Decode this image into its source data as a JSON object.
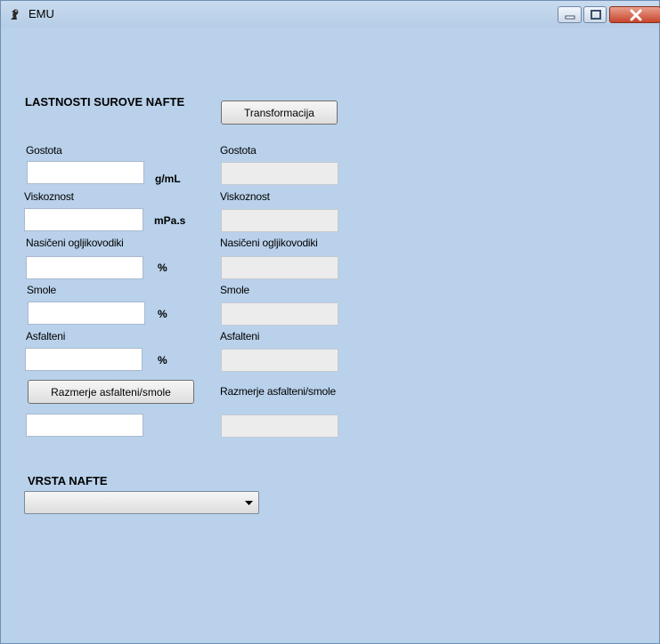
{
  "window": {
    "title": "EMU"
  },
  "section": {
    "heading": "LASTNOSTI SUROVE NAFTE",
    "transform_button": "Transformacija"
  },
  "inputs": {
    "gostota": {
      "label": "Gostota",
      "unit": "g/mL",
      "value": ""
    },
    "viskoznost": {
      "label": "Viskoznost",
      "unit": "mPa.s",
      "value": ""
    },
    "nasiceni": {
      "label": "Nasičeni ogljikovodiki",
      "unit": "%",
      "value": ""
    },
    "smole": {
      "label": "Smole",
      "unit": "%",
      "value": ""
    },
    "asfalteni": {
      "label": "Asfalteni",
      "unit": "%",
      "value": ""
    },
    "ratio_button": "Razmerje asfalteni/smole",
    "ratio_value": ""
  },
  "outputs": {
    "gostota": {
      "label": "Gostota",
      "value": ""
    },
    "viskoznost": {
      "label": "Viskoznost",
      "value": ""
    },
    "nasiceni": {
      "label": "Nasičeni ogljikovodiki",
      "value": ""
    },
    "smole": {
      "label": "Smole",
      "value": ""
    },
    "asfalteni": {
      "label": "Asfalteni",
      "value": ""
    },
    "ratio": {
      "label": "Razmerje asfalteni/smole",
      "value": ""
    }
  },
  "vrsta": {
    "heading": "VRSTA NAFTE",
    "selected": ""
  }
}
